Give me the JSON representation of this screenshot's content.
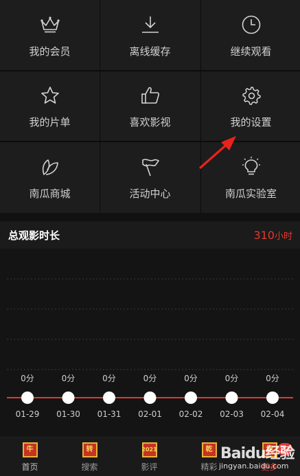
{
  "menu": [
    {
      "label": "我的会员",
      "icon": "crown-icon"
    },
    {
      "label": "离线缓存",
      "icon": "download-icon"
    },
    {
      "label": "继续观看",
      "icon": "clock-icon"
    },
    {
      "label": "我的片单",
      "icon": "star-icon"
    },
    {
      "label": "喜欢影视",
      "icon": "thumbs-up-icon"
    },
    {
      "label": "我的设置",
      "icon": "gear-icon"
    },
    {
      "label": "南瓜商城",
      "icon": "leaf-icon"
    },
    {
      "label": "活动中心",
      "icon": "flag-icon"
    },
    {
      "label": "南瓜实验室",
      "icon": "lightbulb-icon"
    }
  ],
  "stats": {
    "title": "总观影时长",
    "value": "310",
    "unit": "小时"
  },
  "chart_data": {
    "type": "line",
    "categories": [
      "01-29",
      "01-30",
      "01-31",
      "02-01",
      "02-02",
      "02-03",
      "02-04"
    ],
    "values": [
      0,
      0,
      0,
      0,
      0,
      0,
      0
    ],
    "value_labels": [
      "0分",
      "0分",
      "0分",
      "0分",
      "0分",
      "0分",
      "0分"
    ],
    "grid": true,
    "line_color": "#e23a2e"
  },
  "tabbar": [
    {
      "label": "首页",
      "glyph": "牛"
    },
    {
      "label": "搜索",
      "glyph": "转"
    },
    {
      "label": "影评",
      "glyph": "2021"
    },
    {
      "label": "精彩",
      "glyph": "乾"
    },
    {
      "label": "更多",
      "glyph": "坤"
    }
  ],
  "badge": "27",
  "watermark": {
    "logo": "Baidu经验",
    "site": "jingyan.baidu.com"
  },
  "colors": {
    "accent": "#e23a2e",
    "arrow": "#e8231c"
  }
}
